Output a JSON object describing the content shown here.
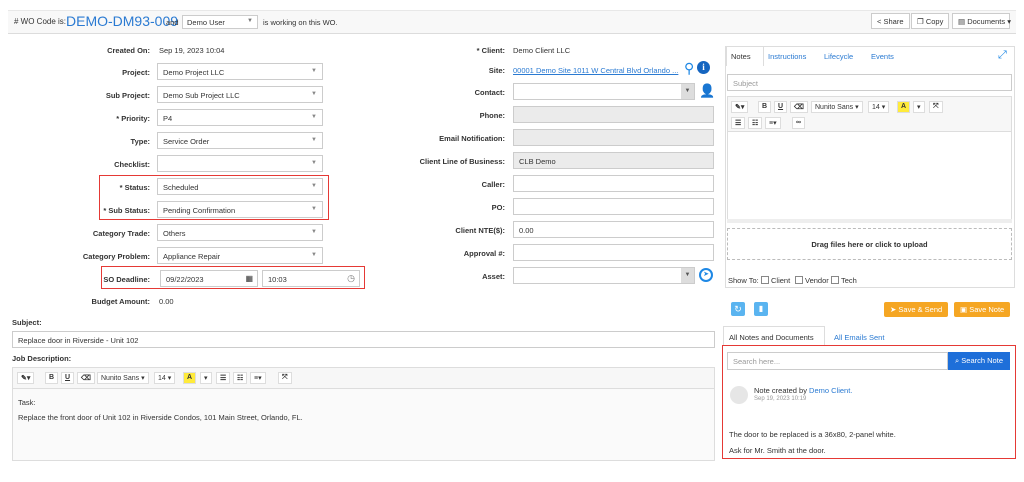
{
  "header": {
    "wo_label": "# WO Code is:",
    "wo_code": "DEMO-DM93-009",
    "and_text": "and",
    "user": "Demo User",
    "working_text": "is working on this WO.",
    "share": "Share",
    "copy": "Copy",
    "documents": "Documents"
  },
  "left": {
    "created_on_label": "Created On:",
    "created_on": "Sep 19, 2023 10:04",
    "project_label": "Project:",
    "project": "Demo Project LLC",
    "sub_project_label": "Sub Project:",
    "sub_project": "Demo Sub Project LLC",
    "priority_label": "* Priority:",
    "priority": "P4",
    "type_label": "Type:",
    "type": "Service Order",
    "checklist_label": "Checklist:",
    "checklist": "",
    "status_label": "* Status:",
    "status": "Scheduled",
    "sub_status_label": "* Sub Status:",
    "sub_status": "Pending Confirmation",
    "category_trade_label": "Category Trade:",
    "category_trade": "Others",
    "category_problem_label": "Category Problem:",
    "category_problem": "Appliance Repair",
    "so_deadline_label": "SO Deadline:",
    "so_deadline_date": "09/22/2023",
    "so_deadline_time": "10:03",
    "budget_label": "Budget Amount:",
    "budget": "0.00"
  },
  "middle": {
    "client_label": "* Client:",
    "client": "Demo Client LLC",
    "site_label": "Site:",
    "site": "00001 Demo Site 1011 W Central Blvd Orlando ...",
    "contact_label": "Contact:",
    "phone_label": "Phone:",
    "email_label": "Email Notification:",
    "clb_label": "Client Line of Business:",
    "clb": "CLB Demo",
    "caller_label": "Caller:",
    "po_label": "PO:",
    "nte_label": "Client NTE($):",
    "nte": "0.00",
    "approval_label": "Approval #:",
    "asset_label": "Asset:"
  },
  "subject": {
    "label": "Subject:",
    "value": "Replace door in Riverside - Unit 102"
  },
  "job": {
    "label": "Job Description:",
    "font": "Nunito Sans",
    "size": "14",
    "line1": "Task:",
    "line2": "Replace the front door of Unit 102 in Riverside Condos, 101 Main Street, Orlando, FL."
  },
  "notes": {
    "tabs": [
      "Notes",
      "Instructions",
      "Lifecycle",
      "Events"
    ],
    "subject_placeholder": "Subject",
    "font": "Nunito Sans",
    "size": "14",
    "drop_text": "Drag files here or click to upload",
    "show_to": "Show To:",
    "client": "Client",
    "vendor": "Vendor",
    "tech": "Tech",
    "save_send": "Save & Send",
    "save_note": "Save Note",
    "list_tabs": [
      "All Notes and Documents",
      "All Emails Sent"
    ],
    "search_placeholder": "Search here...",
    "search_button": "Search Note",
    "note_created_by": "Note created by",
    "note_author": "Demo Client.",
    "note_time": "Sep 19, 2023 10:19",
    "note_line1": "The door to be replaced is a 36x80, 2-panel white.",
    "note_line2": "Ask for Mr. Smith at the door."
  },
  "colors": {
    "accent": "#2a7ad2",
    "highlight": "#e53935",
    "orange": "#f5a623",
    "primary": "#1e6fd9"
  }
}
